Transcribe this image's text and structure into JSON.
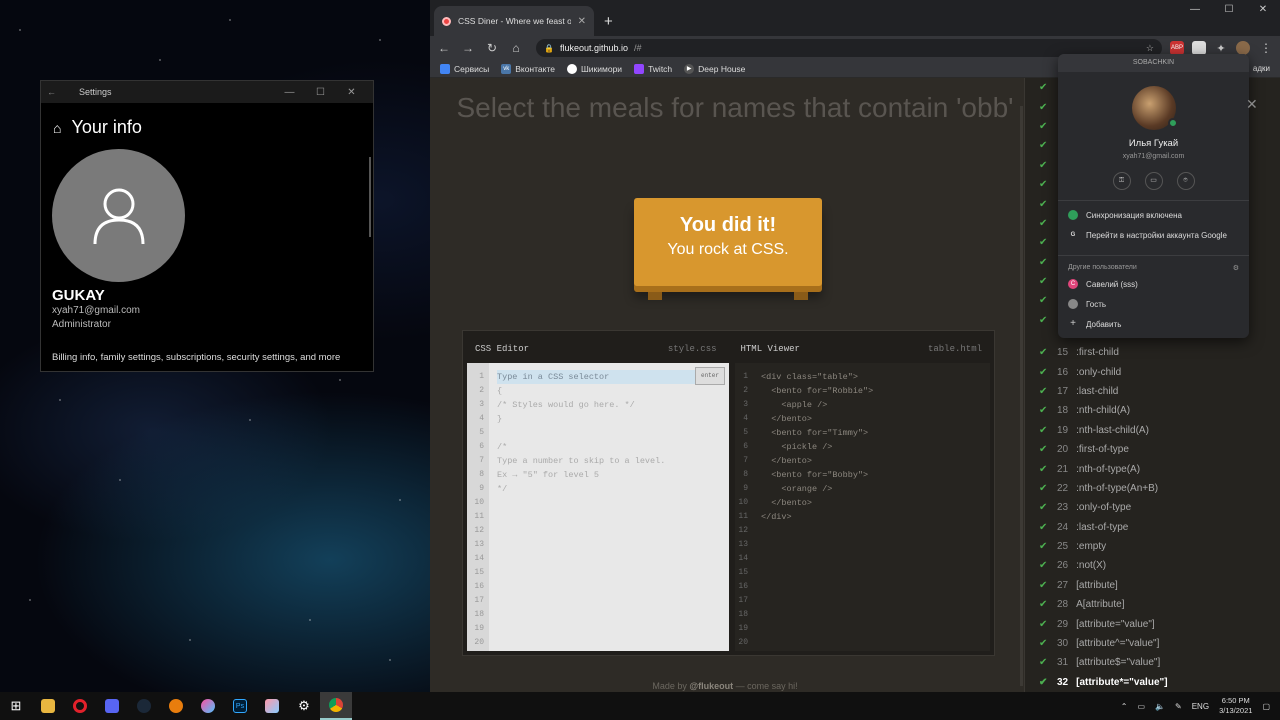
{
  "settings": {
    "window_title": "Settings",
    "heading": "Your info",
    "name": "GUKAY",
    "email": "xyah71@gmail.com",
    "role": "Administrator",
    "billing": "Billing info, family settings, subscriptions, security settings, and more"
  },
  "browser": {
    "tab_title": "CSS Diner - Where we feast on CSS",
    "url_host": "flukeout.github.io",
    "url_path": "/#",
    "bookmarks": [
      "Сервисы",
      "Вконтакте",
      "Шикимори",
      "Twitch",
      "Deep House"
    ],
    "bookmarks_more": "адки"
  },
  "page": {
    "title": "Select the meals for names that contain 'obb'",
    "plate_line1": "You did it!",
    "plate_line2": "You rock at CSS.",
    "css_editor_label": "CSS Editor",
    "css_file": "style.css",
    "html_viewer_label": "HTML Viewer",
    "html_file": "table.html",
    "enter": "enter",
    "css_lines": [
      "Type in a CSS selector",
      "{",
      "/* Styles would go here. */",
      "}",
      "",
      "/*",
      "Type a number to skip to a level.",
      "Ex → \"5\" for level 5",
      "*/"
    ],
    "html_lines": [
      "<div class=\"table\">",
      "  <bento for=\"Robbie\">",
      "    <apple />",
      "  </bento>",
      "  <bento for=\"Timmy\">",
      "    <pickle />",
      "  </bento>",
      "  <bento for=\"Bobby\">",
      "    <orange />",
      "  </bento>",
      "</div>"
    ],
    "footer_pre": "Made by ",
    "footer_author": "@flukeout",
    "footer_post": " — come say hi!"
  },
  "levels": [
    [
      "15",
      ":first-child"
    ],
    [
      "16",
      ":only-child"
    ],
    [
      "17",
      ":last-child"
    ],
    [
      "18",
      ":nth-child(A)"
    ],
    [
      "19",
      ":nth-last-child(A)"
    ],
    [
      "20",
      ":first-of-type"
    ],
    [
      "21",
      ":nth-of-type(A)"
    ],
    [
      "22",
      ":nth-of-type(An+B)"
    ],
    [
      "23",
      ":only-of-type"
    ],
    [
      "24",
      ":last-of-type"
    ],
    [
      "25",
      ":empty"
    ],
    [
      "26",
      ":not(X)"
    ],
    [
      "27",
      "[attribute]"
    ],
    [
      "28",
      "A[attribute]"
    ],
    [
      "29",
      "[attribute=\"value\"]"
    ],
    [
      "30",
      "[attribute^=\"value\"]"
    ],
    [
      "31",
      "[attribute$=\"value\"]"
    ],
    [
      "32",
      "[attribute*=\"value\"]"
    ]
  ],
  "profile": {
    "top": "SOBACHKIN",
    "name": "Илья Гукай",
    "email": "xyah71@gmail.com",
    "sync": "Синхронизация включена",
    "google": "Перейти в настройки аккаунта Google",
    "others": "Другие пользователи",
    "user1": "Савелий (sss)",
    "guest": "Гость",
    "add": "Добавить"
  },
  "tray": {
    "lang": "ENG",
    "time": "6:50 PM",
    "date": "3/13/2021"
  }
}
